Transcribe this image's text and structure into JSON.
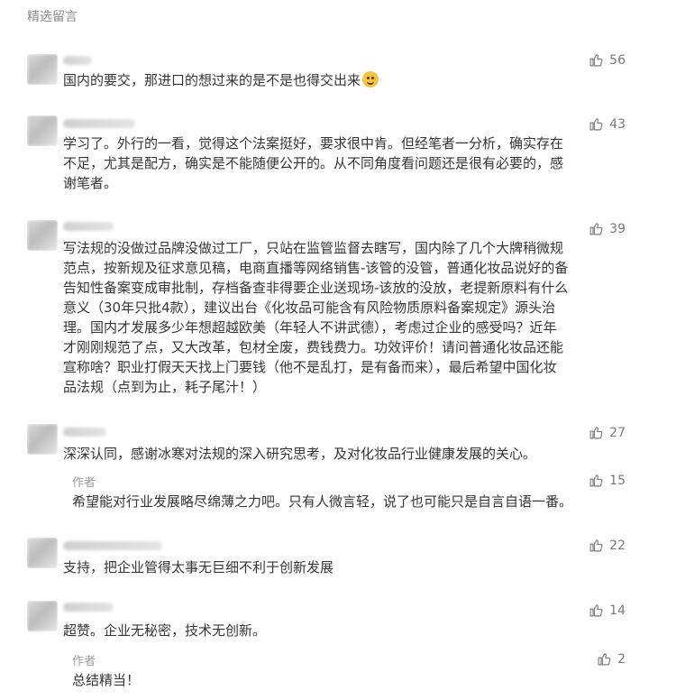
{
  "section_title": "精选留言",
  "comments": [
    {
      "text": "国内的要交，那进口的想过来的是不是也得交出来",
      "likes": "56"
    },
    {
      "text": "学习了。外行的一看，觉得这个法案挺好，要求很中肯。但经笔者一分析，确实存在\n不足，尤其是配方，确实是不能随便公开的。从不同角度看问题还是很有必要的，感\n谢笔者。",
      "likes": "43"
    },
    {
      "text": "写法规的没做过品牌没做过工厂，只站在监管监督去瞎写，国内除了几个大牌稍微规\n范点，按新规及征求意见稿，电商直播等网络销售-该管的没管，普通化妆品说好的备\n告知性备案变成审批制，存档备查非得要企业送现场-该放的没放，老提新原料有什么\n意义（30年只批4款），建议出台《化妆品可能含有风险物质原料备案规定》源头治\n理。国内才发展多少年想超越欧美（年轻人不讲武德），考虑过企业的感受吗？近年\n才刚刚规范了点，又大改革，包材全废，费钱费力。功效评价！请问普通化妆品还能\n宣称啥？职业打假天天找上门要钱（他不是乱打，是有备而来），最后希望中国化妆\n品法规（点到为止，耗子尾汁！）",
      "likes": "39"
    },
    {
      "text": "深深认同，感谢冰寒对法规的深入研究思考，及对化妆品行业健康发展的关心。",
      "likes": "27",
      "reply": {
        "author": "作者",
        "text": "希望能对行业发展略尽绵薄之力吧。只有人微言轻，说了也可能只是自言自语一番。",
        "likes": "15"
      }
    },
    {
      "text": "支持，把企业管得太事无巨细不利于创新发展",
      "likes": "22"
    },
    {
      "text": "超赞。企业无秘密，技术无创新。",
      "likes": "14",
      "reply": {
        "author": "作者",
        "text": "总结精当！",
        "likes": "2"
      }
    }
  ],
  "icons": {
    "like": "thumbs-up-icon",
    "emoji": "grin-emoji-icon"
  },
  "colors": {
    "muted": "#8a8a8a",
    "text": "#353535",
    "like": "#7a7a7a"
  }
}
